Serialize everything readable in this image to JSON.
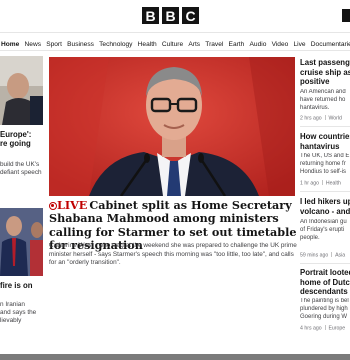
{
  "logo": {
    "letters": [
      "B",
      "B",
      "C"
    ]
  },
  "nav": {
    "items": [
      "Home",
      "News",
      "Sport",
      "Business",
      "Technology",
      "Health",
      "Culture",
      "Arts",
      "Travel",
      "Earth",
      "Audio",
      "Video",
      "Live",
      "Documentaries"
    ]
  },
  "left": {
    "story1": {
      "head": "Europe':",
      "head2": "re going",
      "sum1": "build the UK's",
      "sum2": "defiant speech"
    },
    "story2": {
      "head": "fire is on",
      "sum1": "n Iranian",
      "sum2": "and says the",
      "sum3": "lievably"
    }
  },
  "main": {
    "live_label": "LIVE",
    "headline": "Cabinet split as Home Secretary Shabana Mahmood among ministers calling for Starmer to set out timetable for resignation",
    "summary": "Catherine West - who said at the weekend she was prepared to challenge the UK prime minister herself - says Starmer's speech this morning was \"too little, too late\", and calls for an \"orderly transition\"."
  },
  "right": [
    {
      "head": [
        "Last passenger",
        "cruise ship as t",
        "positive"
      ],
      "sum": [
        "An American and",
        "have returned ho",
        "hantavirus."
      ],
      "time": "2 hrs ago",
      "tag": "World"
    },
    {
      "head": [
        "How countries",
        "hantavirus"
      ],
      "sum": [
        "The UK, US and E",
        "returning home fr",
        "Hondius to self-is"
      ],
      "time": "1 hr ago",
      "tag": "Health"
    },
    {
      "head": [
        "I led hikers up",
        "volcano - and t"
      ],
      "sum": [
        "An Indonesian gu",
        "of Friday's erupti",
        "people."
      ],
      "time": "59 mins ago",
      "tag": "Asia"
    },
    {
      "head": [
        "Portrait looted",
        "home of Dutch",
        "descendants"
      ],
      "sum": [
        "The painting is bel",
        "plundered by high",
        "Goering during W"
      ],
      "time": "4 hrs ago",
      "tag": "Europe"
    }
  ]
}
